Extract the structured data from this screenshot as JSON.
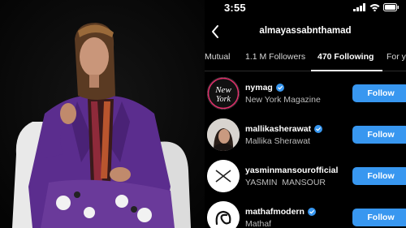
{
  "status": {
    "time": "3:55"
  },
  "header": {
    "username": "almayassabnthamad"
  },
  "tabs": [
    {
      "label": "Mutual",
      "active": false
    },
    {
      "label": "1.1 M Followers",
      "active": false
    },
    {
      "label": "470 Following",
      "active": true
    },
    {
      "label": "For y",
      "active": false
    }
  ],
  "accounts": [
    {
      "handle": "nymag",
      "name": "New York Magazine",
      "verified": true,
      "button": "Follow",
      "avatar_logo": "New York"
    },
    {
      "handle": "mallikasherawat",
      "name": "Mallika Sherawat",
      "verified": true,
      "button": "Follow"
    },
    {
      "handle": "yasminmansourofficial",
      "name": "YASMIN  MANSOUR",
      "verified": false,
      "button": "Follow"
    },
    {
      "handle": "mathafmodern",
      "name": "Mathaf",
      "verified": true,
      "button": "Follow"
    }
  ],
  "colors": {
    "follow_button": "#3897f0",
    "verified_badge": "#3897f0",
    "suit": "#5b2d8e"
  }
}
